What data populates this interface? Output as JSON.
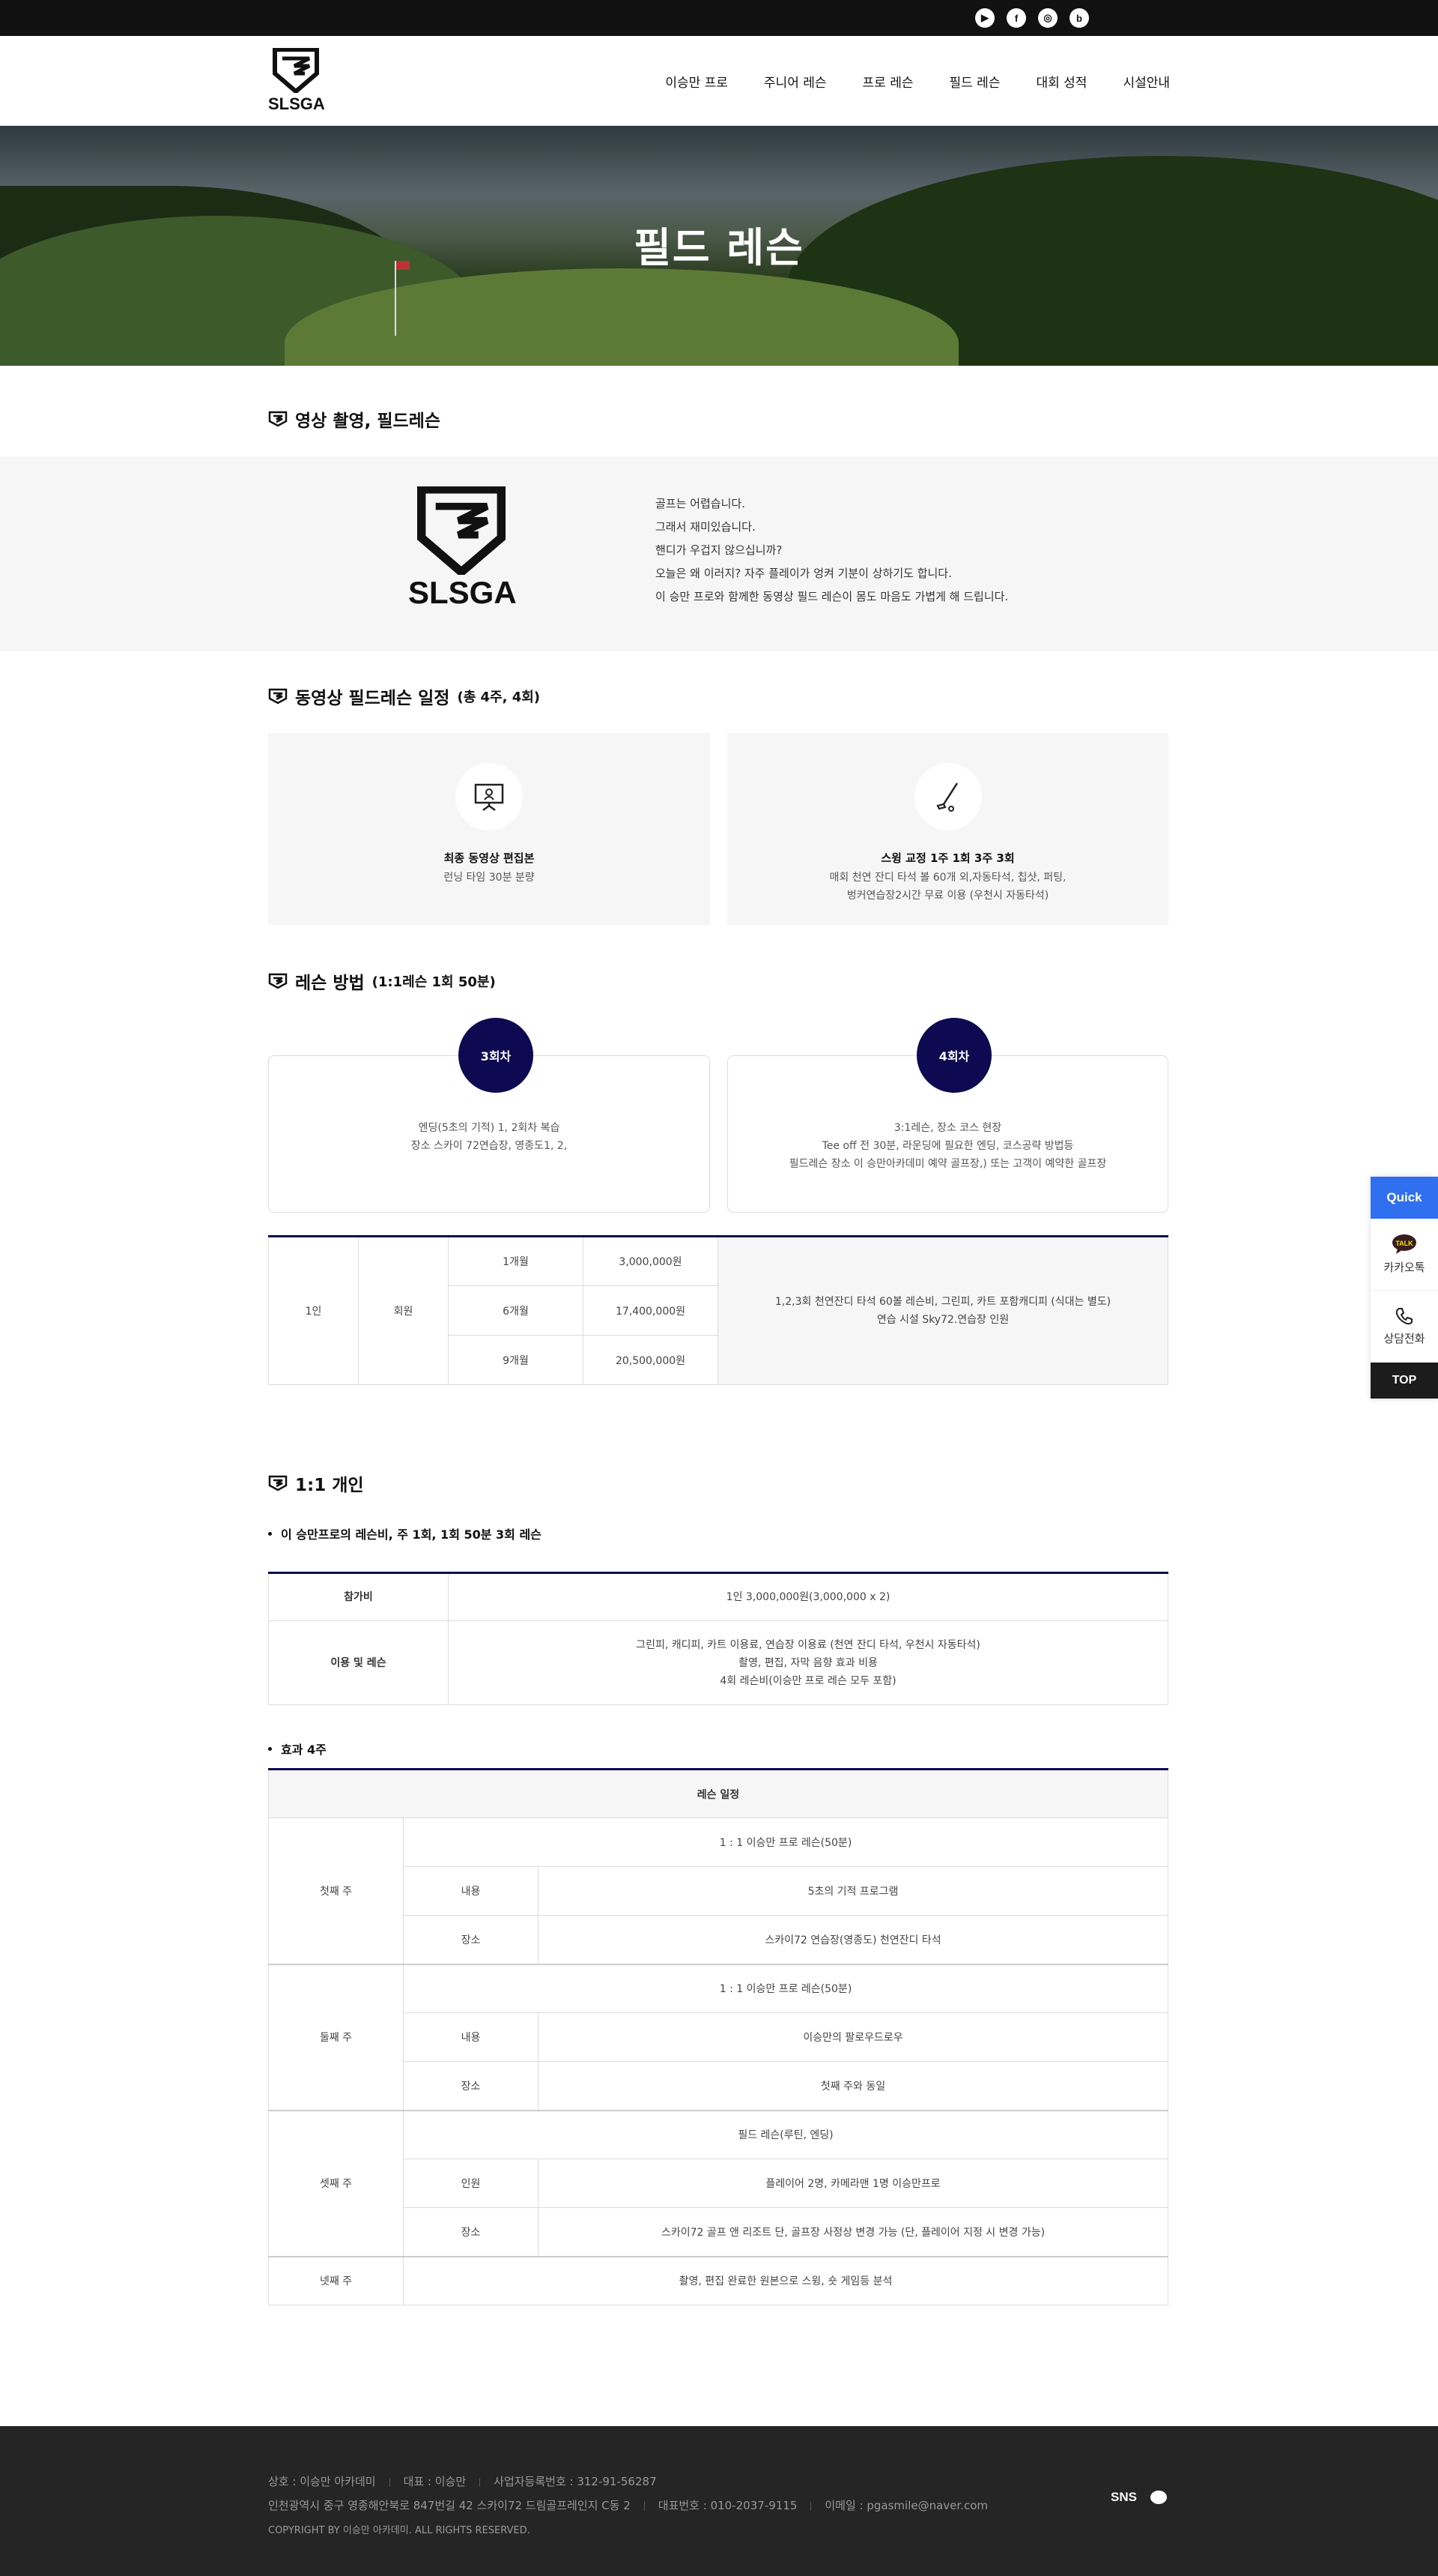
{
  "sns_top": [
    "▶",
    "f",
    "◎",
    "b"
  ],
  "header": {
    "logo_text": "SLSGA",
    "nav": [
      "이승만 프로",
      "주니어 레슨",
      "프로 레슨",
      "필드 레슨",
      "대회 성적",
      "시설안내"
    ]
  },
  "hero": {
    "title": "필드 레슨"
  },
  "section1": {
    "title": "영상 촬영, 필드레슨",
    "logo_text": "SLSGA",
    "lines": [
      "골프는 어렵습니다.",
      "그래서 재미있습니다.",
      "핸디가 우겁지 않으십니까?",
      "오늘은 왜 이러지? 자주 플레이가 엉켜 기분이 상하기도 합니다.",
      "이 승만 프로와 함께한 동영상 필드 레슨이 몸도 마음도 가볍게 해 드립니다."
    ]
  },
  "section2": {
    "title": "동영상 필드레슨 일정",
    "sub": "(총 4주, 4회)",
    "cards": [
      {
        "icon": "presentation-icon",
        "title": "최종 동영상 편집본",
        "desc": [
          "런닝 타임 30분 분량"
        ]
      },
      {
        "icon": "golf-club-icon",
        "title": "스윙 교정 1주 1회 3주 3회",
        "desc": [
          "매회 천연 잔디 타석 볼 60개 외,자동타석, 칩샷, 퍼팅,",
          "벙커연습장2시간 무료 이용 (우천시 자동타석)"
        ]
      }
    ]
  },
  "section3": {
    "title": "레슨 방법",
    "sub": "(1:1레슨 1회 50분)",
    "cards": [
      {
        "badge": "3회차",
        "desc": [
          "엔딩(5초의 기적) 1, 2회차 복습",
          "장소 스카이 72연습장, 영종도1, 2,"
        ]
      },
      {
        "badge": "4회차",
        "desc": [
          "3:1레슨, 장소 코스 현장",
          "Tee off 전 30분, 라운딩에 필요한 엔딩, 코스공략 방법등",
          "필드레슨 장소 이 승만아카데미 예약 골프장,) 또는 고객이 예약한 골프장"
        ]
      }
    ],
    "table": {
      "people": "1인",
      "member": "회원",
      "rows": [
        {
          "period": "1개월",
          "price": "3,000,000원"
        },
        {
          "period": "6개월",
          "price": "17,400,000원"
        },
        {
          "period": "9개월",
          "price": "20,500,000원"
        }
      ],
      "note": [
        "1,2,3회 천연잔디 타석 60볼 레슨비, 그린피, 카트 포함캐디피 (식대는 별도)",
        "연습 시설 Sky72.연습장 인원"
      ]
    }
  },
  "section4": {
    "title": "1:1 개인",
    "bullet1": "이 승만프로의 레슨비, 주 1회, 1회 50분 3회 레슨",
    "table1": [
      {
        "label": "참가비",
        "value": [
          "1인 3,000,000원(3,000,000 x 2)"
        ]
      },
      {
        "label": "이용 및 레슨",
        "value": [
          "그린피, 캐디피, 카트 이용료, 연습장 이용료 (천연 잔디 타석, 우천시 자동타석)",
          "촬영, 편집, 자막 음향 효과 비용",
          "4회 레슨비(이승만 프로 레슨 모두 포함)"
        ]
      }
    ],
    "bullet2": "효과 4주",
    "schedule_head": "레슨 일정",
    "weeks": [
      {
        "week": "첫째 주",
        "title": "1 : 1 이승만 프로 레슨(50분)",
        "rows": [
          {
            "label": "내용",
            "value": "5초의 기적 프로그램"
          },
          {
            "label": "장소",
            "value": "스카이72 연습장(영종도) 천연잔디 타석"
          }
        ]
      },
      {
        "week": "둘째 주",
        "title": "1 : 1 이승만 프로 레슨(50분)",
        "rows": [
          {
            "label": "내용",
            "value": "이승만의 팔로우드로우"
          },
          {
            "label": "장소",
            "value": "첫째 주와 동일"
          }
        ]
      },
      {
        "week": "셋째 주",
        "title": "필드 레슨(루틴, 엔딩)",
        "rows": [
          {
            "label": "인원",
            "value": "플레이어 2명, 카메라맨 1명 이승만프로"
          },
          {
            "label": "장소",
            "value": "스카이72 골프 앤 리조트 단, 골프장 사정상 변경 가능 (단, 플레이어 지정 시 변경 가능)"
          }
        ]
      },
      {
        "week": "넷째 주",
        "title": "촬영, 편집 완료한 원본으로 스윙, 숏 게임등 분석",
        "rows": []
      }
    ]
  },
  "quick": {
    "title": "Quick",
    "kakao": "카카오톡",
    "kakao_badge": "TALK",
    "call": "상담전화",
    "top": "TOP"
  },
  "footer": {
    "line1": [
      "상호 : 이승만 아카데미",
      "대표 : 이승만",
      "사업자등록번호 : 312-91-56287"
    ],
    "line2": [
      "인천광역시 중구 영종해안북로 847번길 42 스카이72 드림골프레인지 C동 2",
      "대표번호 : 010-2037-9115",
      "이메일 : pgasmile@naver.com"
    ],
    "copyright": "COPYRIGHT BY 이승만 아카데미. ALL RIGHTS RESERVED.",
    "sns": "SNS"
  }
}
